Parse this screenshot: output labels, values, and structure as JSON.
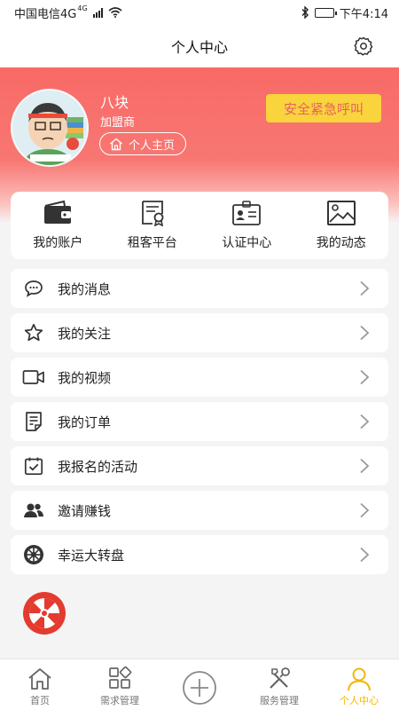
{
  "status": {
    "carrier": "中国电信4G",
    "network_badge": "4G",
    "time": "下午4:14"
  },
  "nav": {
    "title": "个人中心",
    "settings_icon": "gear-icon"
  },
  "profile": {
    "name": "八块",
    "role": "加盟商",
    "home_button": "个人主页",
    "sos_button": "安全紧急呼叫"
  },
  "quick_links": [
    {
      "label": "我的账户",
      "icon": "wallet-icon"
    },
    {
      "label": "租客平台",
      "icon": "certificate-icon"
    },
    {
      "label": "认证中心",
      "icon": "id-card-icon"
    },
    {
      "label": "我的动态",
      "icon": "image-icon"
    }
  ],
  "menu": [
    {
      "label": "我的消息",
      "icon": "chat-bubble-icon"
    },
    {
      "label": "我的关注",
      "icon": "star-icon"
    },
    {
      "label": "我的视频",
      "icon": "video-camera-icon"
    },
    {
      "label": "我的订单",
      "icon": "document-icon"
    },
    {
      "label": "我报名的活动",
      "icon": "calendar-check-icon"
    },
    {
      "label": "邀请赚钱",
      "icon": "users-icon"
    },
    {
      "label": "幸运大转盘",
      "icon": "wheel-icon"
    }
  ],
  "tabs": [
    {
      "label": "首页",
      "icon": "home-icon",
      "active": false
    },
    {
      "label": "需求管理",
      "icon": "grid-icon",
      "active": false
    },
    {
      "label": "",
      "icon": "plus-circle-icon",
      "active": false
    },
    {
      "label": "服务管理",
      "icon": "tools-icon",
      "active": false
    },
    {
      "label": "个人中心",
      "icon": "user-icon",
      "active": true
    }
  ],
  "colors": {
    "accent_red": "#f86a66",
    "sos_yellow": "#f9d43d",
    "active_tab": "#f2b705"
  }
}
